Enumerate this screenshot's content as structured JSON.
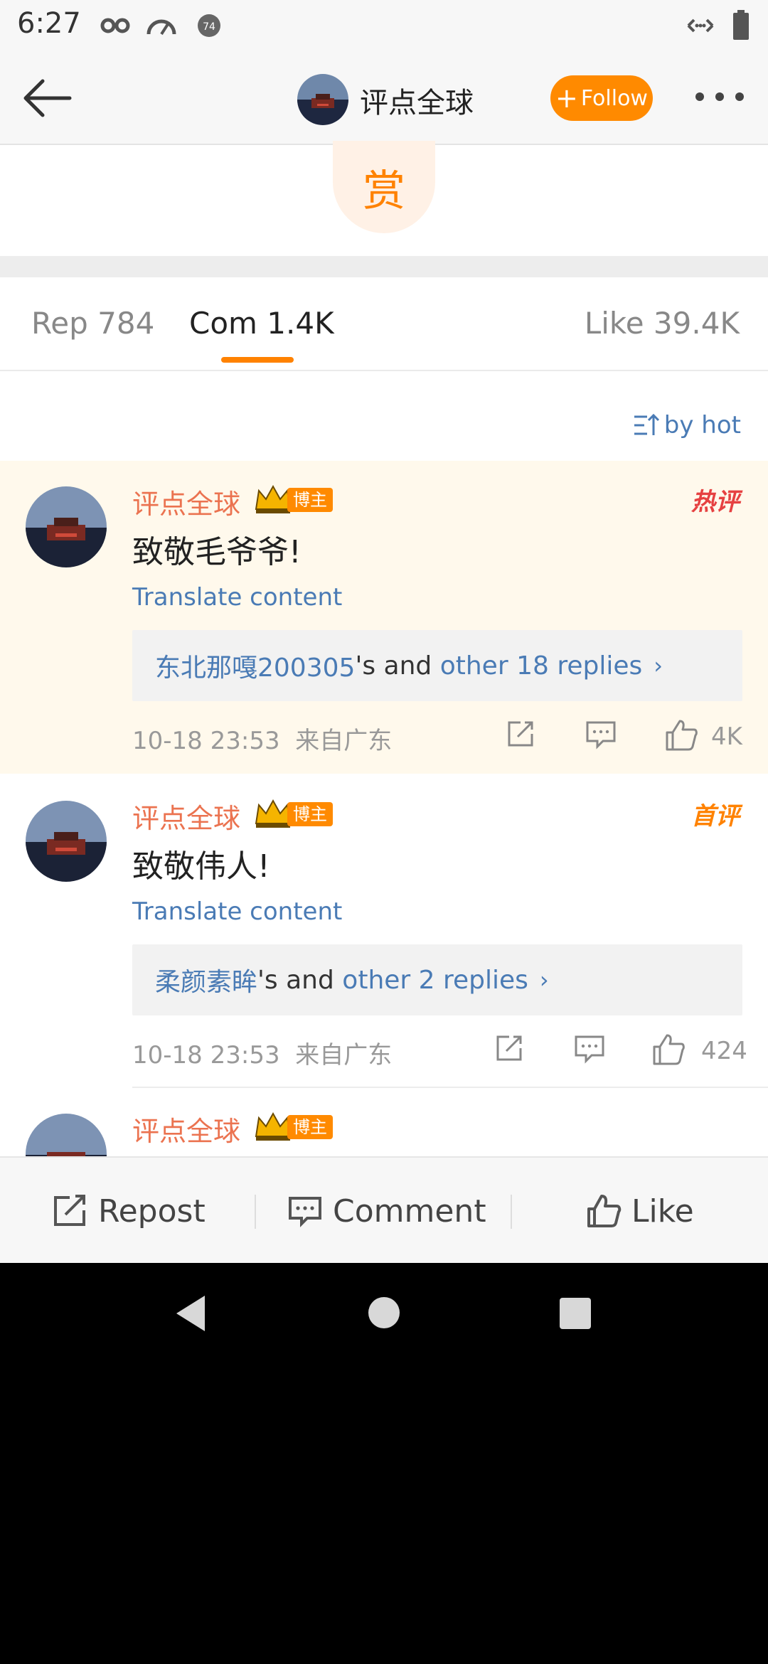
{
  "status_bar": {
    "time": "6:27"
  },
  "nav": {
    "title": "评点全球",
    "follow_label": "Follow"
  },
  "reward": {
    "label": "赏"
  },
  "tabs": [
    {
      "label": "Rep 784"
    },
    {
      "label": "Com 1.4K"
    },
    {
      "label": "Like 39.4K"
    }
  ],
  "sort": {
    "label": "by hot"
  },
  "comments": [
    {
      "username": "评点全球",
      "badge": "博主",
      "tag": "热评",
      "text": "致敬毛爷爷!",
      "translate": "Translate content",
      "reply_user": "东北那嘎200305",
      "reply_mid": "'s and ",
      "reply_more": "other 18 replies",
      "meta": "10-18 23:53  来自广东",
      "likes": "4K"
    },
    {
      "username": "评点全球",
      "badge": "博主",
      "tag": "首评",
      "text": "致敬伟人!",
      "translate": "Translate content",
      "reply_user": "柔颜素眸",
      "reply_mid": "'s and ",
      "reply_more": "other 2 replies",
      "meta": "10-18 23:53  来自广东",
      "likes": "424"
    },
    {
      "username": "评点全球",
      "badge": "博主"
    }
  ],
  "bottom_bar": {
    "repost": "Repost",
    "comment": "Comment",
    "like": "Like"
  },
  "colors": {
    "accent": "#ff8200",
    "link": "#4a7bb5",
    "username": "#eb7350",
    "hot_bg": "#fff9ec"
  }
}
